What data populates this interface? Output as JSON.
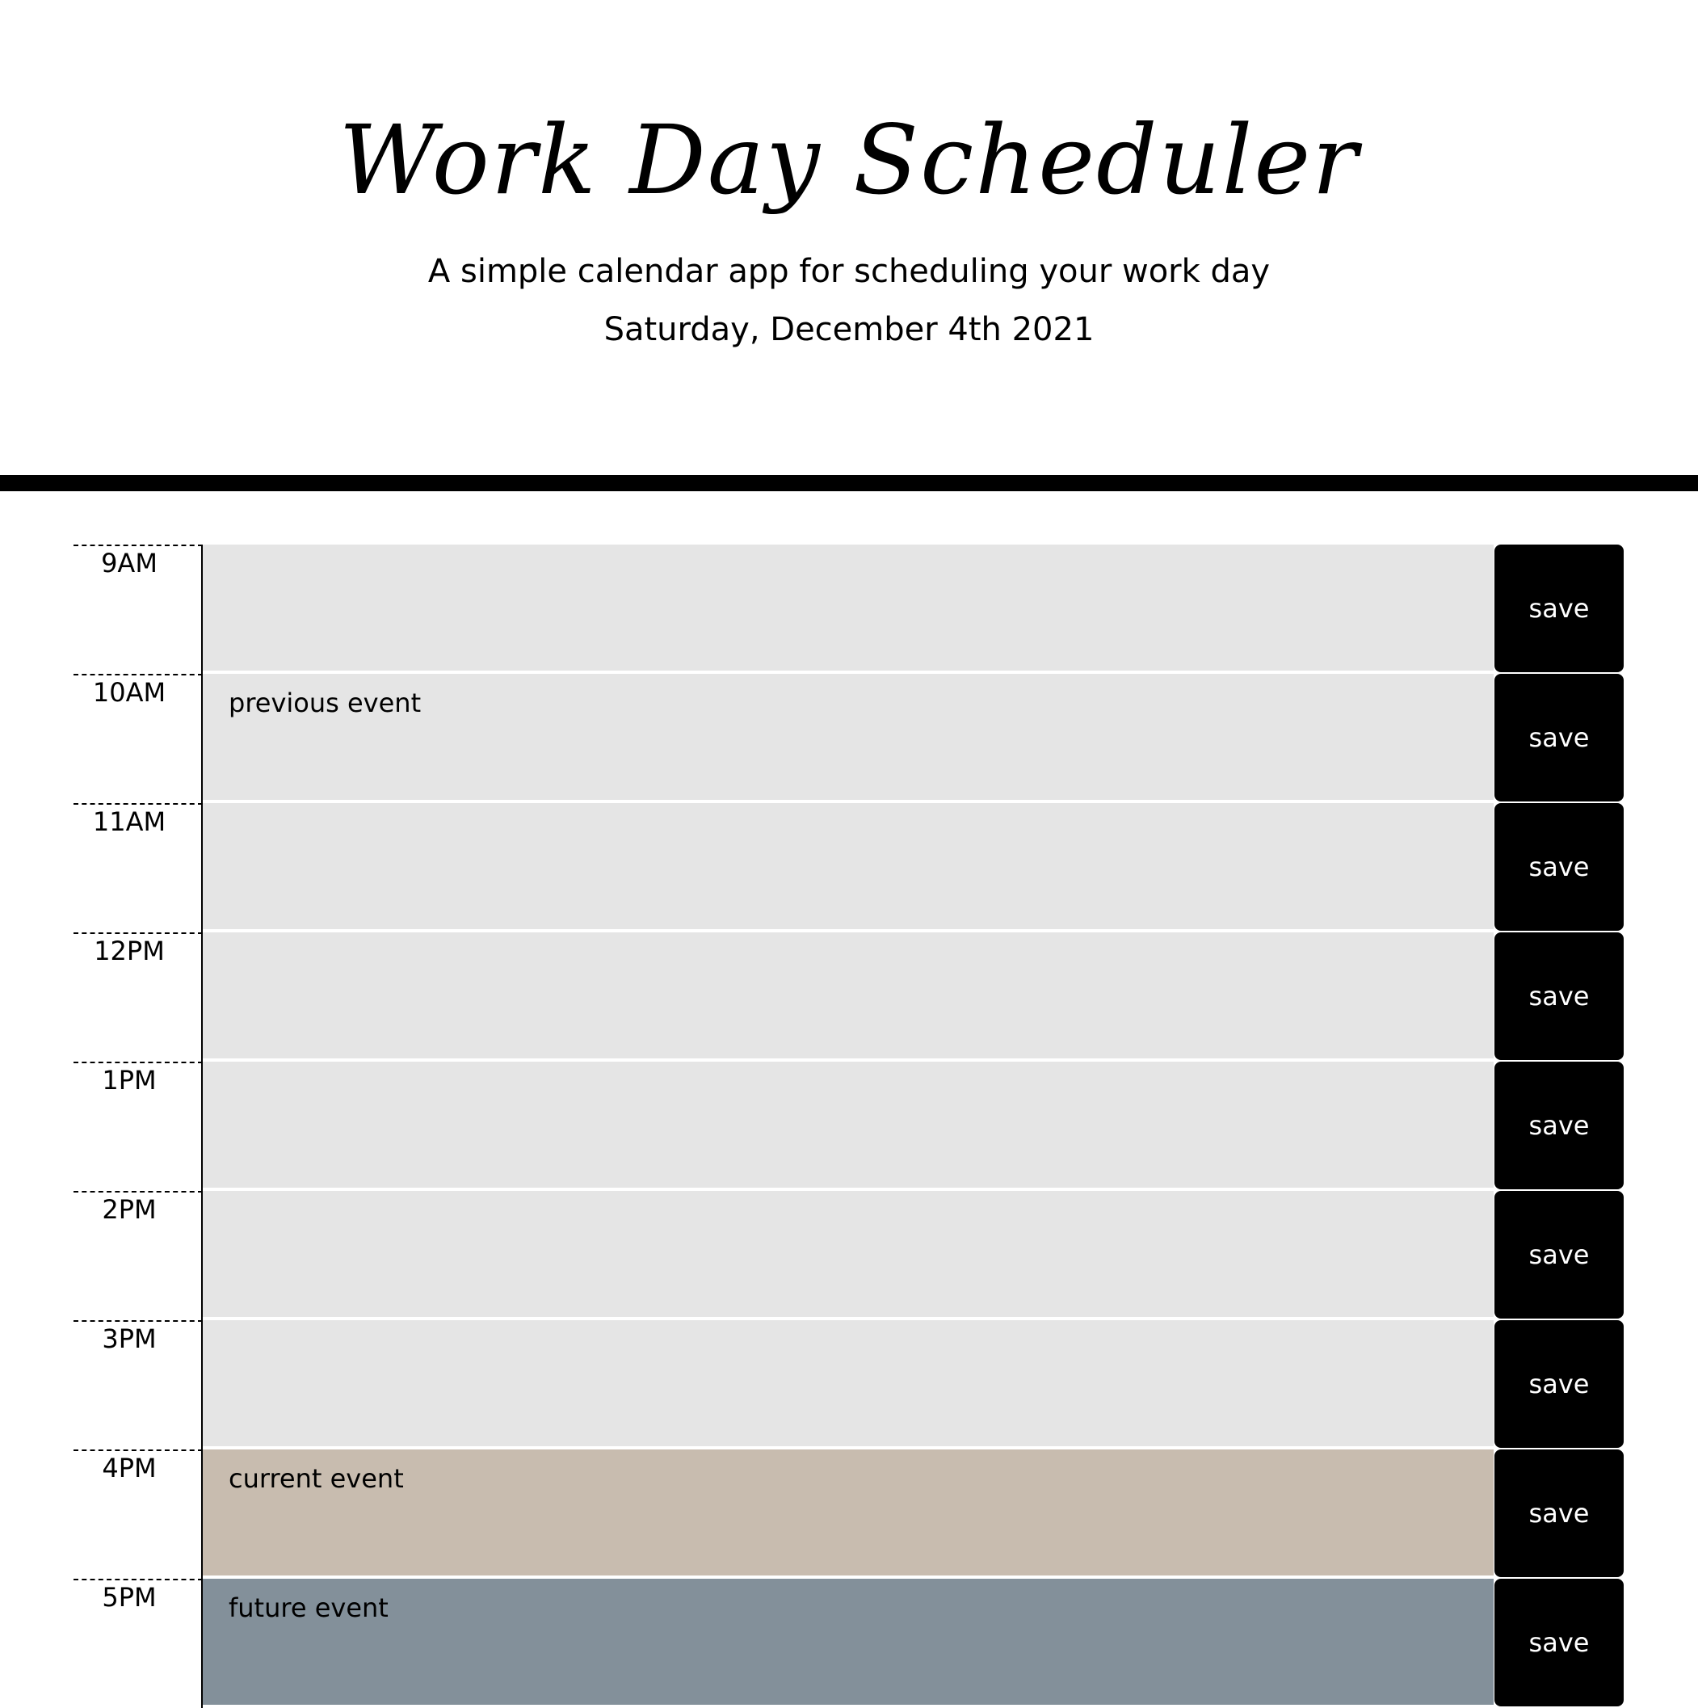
{
  "header": {
    "title": "Work Day Scheduler",
    "subtitle": "A simple calendar app for scheduling your work day",
    "current_day": "Saturday, December 4th 2021"
  },
  "colors": {
    "past": "#e5e5e5",
    "present": "#c8bcaf",
    "future": "#83909a",
    "save_button": "#000000"
  },
  "rows": [
    {
      "hour": "9AM",
      "text": "",
      "state": "past",
      "save_label": "save"
    },
    {
      "hour": "10AM",
      "text": "previous event",
      "state": "past",
      "save_label": "save"
    },
    {
      "hour": "11AM",
      "text": "",
      "state": "past",
      "save_label": "save"
    },
    {
      "hour": "12PM",
      "text": "",
      "state": "past",
      "save_label": "save"
    },
    {
      "hour": "1PM",
      "text": "",
      "state": "past",
      "save_label": "save"
    },
    {
      "hour": "2PM",
      "text": "",
      "state": "past",
      "save_label": "save"
    },
    {
      "hour": "3PM",
      "text": "",
      "state": "past",
      "save_label": "save"
    },
    {
      "hour": "4PM",
      "text": "current event",
      "state": "present",
      "save_label": "save"
    },
    {
      "hour": "5PM",
      "text": "future event",
      "state": "future",
      "save_label": "save"
    }
  ]
}
